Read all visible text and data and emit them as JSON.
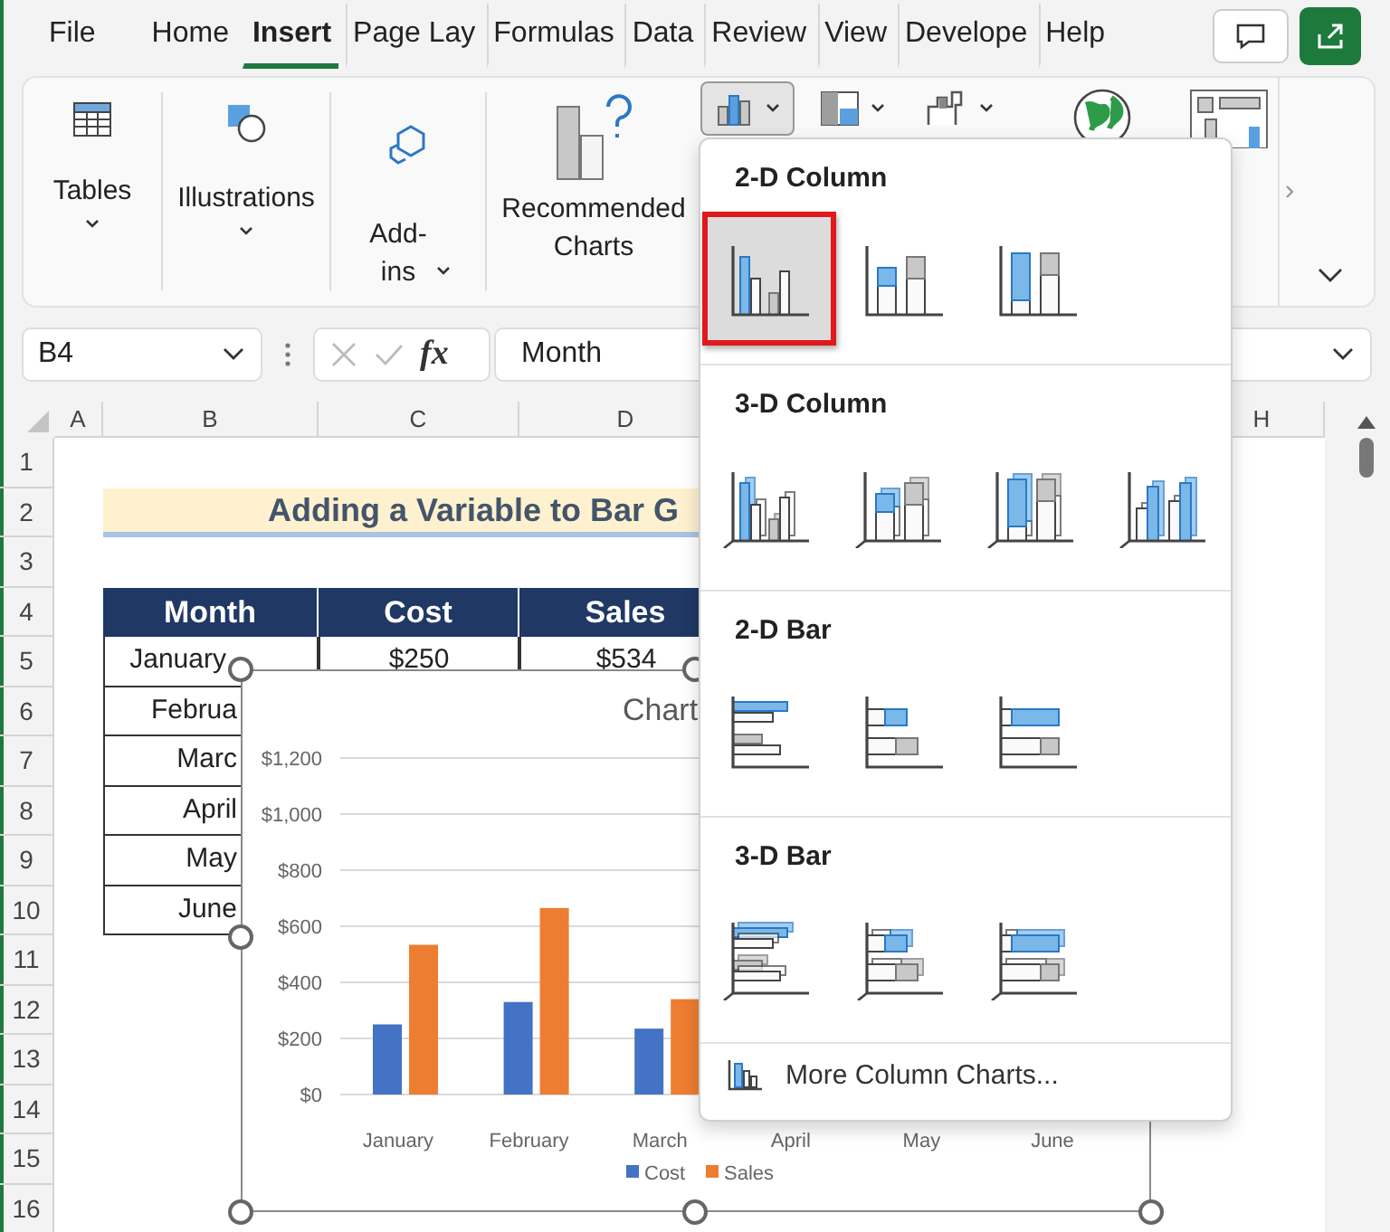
{
  "ribbon_tabs": [
    {
      "label": "File",
      "selected": false
    },
    {
      "label": "Home",
      "selected": false
    },
    {
      "label": "Insert",
      "selected": true
    },
    {
      "label": "Page Lay",
      "selected": false
    },
    {
      "label": "Formulas",
      "selected": false
    },
    {
      "label": "Data",
      "selected": false
    },
    {
      "label": "Review",
      "selected": false
    },
    {
      "label": "View",
      "selected": false
    },
    {
      "label": "Develope",
      "selected": false
    },
    {
      "label": "Help",
      "selected": false
    }
  ],
  "ribbon_groups": [
    {
      "label": "Tables",
      "kind": "tables",
      "has_menu": true
    },
    {
      "label": "Illustrations",
      "kind": "illustrations",
      "has_menu": true
    },
    {
      "label": "Add-ins",
      "kind": "addins",
      "has_menu": true
    },
    {
      "label": "Recommended Charts",
      "kind": "recommended",
      "has_menu": false
    }
  ],
  "chart_buttons": [
    {
      "kind": "column",
      "selected": true,
      "has_menu": true
    },
    {
      "kind": "hierarchy",
      "selected": false,
      "has_menu": true
    },
    {
      "kind": "waterfall",
      "selected": false,
      "has_menu": true
    },
    {
      "kind": "map",
      "selected": false,
      "has_menu": false
    },
    {
      "kind": "pivot",
      "selected": false,
      "has_menu": false
    }
  ],
  "formula_bar": {
    "name_box": "B4",
    "function_label": "fx",
    "value": "Month"
  },
  "columns": [
    "A",
    "B",
    "C",
    "D",
    "H"
  ],
  "rows": [
    "1",
    "2",
    "3",
    "4",
    "5",
    "6",
    "7",
    "8",
    "9",
    "10",
    "11",
    "12",
    "13",
    "14",
    "15",
    "16"
  ],
  "sheet": {
    "title": "Adding a Variable to Bar G",
    "table_header": [
      "Month",
      "Cost",
      "Sales"
    ],
    "table_rows": [
      [
        "January",
        "$250",
        "$534"
      ],
      [
        "Februa"
      ],
      [
        "Marc"
      ],
      [
        "April"
      ],
      [
        "May"
      ],
      [
        "June"
      ]
    ]
  },
  "chart": {
    "chart_data": {
      "type": "bar",
      "title": "Chart",
      "categories": [
        "January",
        "February",
        "March",
        "April",
        "May",
        "June"
      ],
      "series": [
        {
          "name": "Cost",
          "color": "#4472c4",
          "values": [
            250,
            330,
            235,
            null,
            null,
            null
          ]
        },
        {
          "name": "Sales",
          "color": "#ed7d31",
          "values": [
            534,
            665,
            340,
            null,
            null,
            null
          ]
        }
      ],
      "ylim": [
        0,
        1200
      ],
      "grid": true,
      "legend": "bottom",
      "yticks": [
        {
          "value": 0,
          "label": "$0"
        },
        {
          "value": 200,
          "label": "$200"
        },
        {
          "value": 400,
          "label": "$400"
        },
        {
          "value": 600,
          "label": "$600"
        },
        {
          "value": 800,
          "label": "$800"
        },
        {
          "value": 1000,
          "label": "$1,000"
        },
        {
          "value": 1200,
          "label": "$1,200"
        }
      ]
    }
  },
  "chart_menu": {
    "sections": [
      {
        "title": "2-D Column",
        "kind": "column",
        "items": [
          {
            "kind": "clustered",
            "selected": true
          },
          {
            "kind": "stacked",
            "selected": false
          },
          {
            "kind": "percent",
            "selected": false
          }
        ]
      },
      {
        "title": "3-D Column",
        "kind": "column3d",
        "items": [
          {
            "kind": "clustered",
            "selected": false
          },
          {
            "kind": "stacked",
            "selected": false
          },
          {
            "kind": "percent",
            "selected": false
          },
          {
            "kind": "depth",
            "selected": false
          }
        ]
      },
      {
        "title": "2-D Bar",
        "kind": "bar",
        "items": [
          {
            "kind": "clustered",
            "selected": false
          },
          {
            "kind": "stacked",
            "selected": false
          },
          {
            "kind": "percent",
            "selected": false
          }
        ]
      },
      {
        "title": "3-D Bar",
        "kind": "bar3d",
        "items": [
          {
            "kind": "clustered",
            "selected": false
          },
          {
            "kind": "stacked",
            "selected": false
          },
          {
            "kind": "percent",
            "selected": false
          }
        ]
      }
    ],
    "footer": "More Column Charts..."
  }
}
